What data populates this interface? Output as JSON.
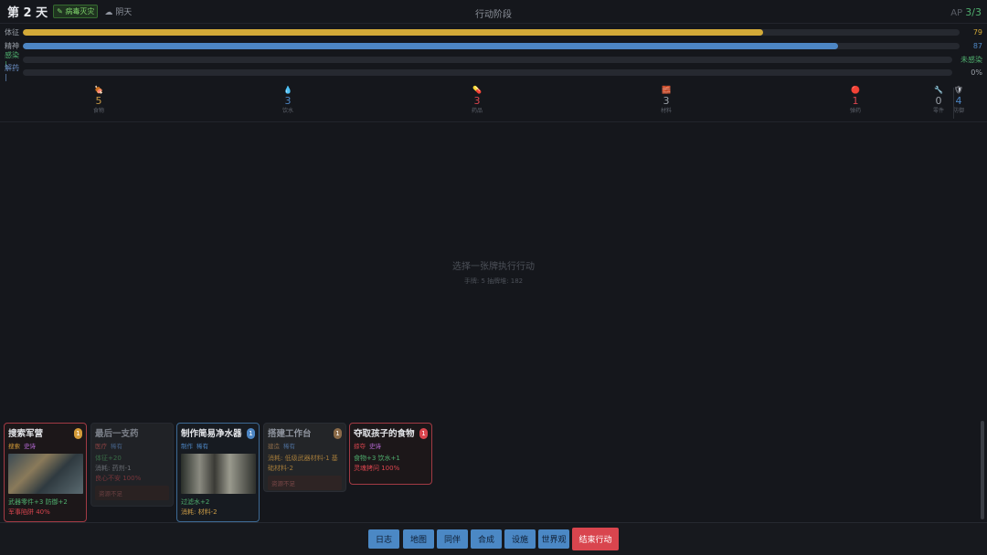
{
  "header": {
    "day_label": "第 2 天",
    "event_tag": "病毒灭灾",
    "weather": "阴天",
    "phase": "行动阶段",
    "ap_label": "AP",
    "ap_value": "3/3"
  },
  "stats": [
    {
      "label": "体征",
      "value": 79,
      "display": "79",
      "color": "#d3aa38",
      "val_color": "#d3aa38"
    },
    {
      "label": "精神",
      "value": 87,
      "display": "87",
      "color": "#4d86c4",
      "val_color": "#4d86c4"
    },
    {
      "label": "感染",
      "value": 0,
      "display": "未感染",
      "color": "#4fae6e",
      "val_color": "#4fae6e",
      "label_color": "#4fae6e"
    },
    {
      "label": "解药",
      "value": 0,
      "display": "0%",
      "color": "#6b8fc4",
      "val_color": "#9aa0a8",
      "label_color": "#6b8fc4"
    }
  ],
  "resources": [
    {
      "icon": "🍖",
      "value": "5",
      "label": "食物",
      "color": "#c89a46"
    },
    {
      "icon": "💧",
      "value": "3",
      "label": "饮水",
      "color": "#4d86c4"
    },
    {
      "icon": "💊",
      "value": "3",
      "label": "药品",
      "color": "#d9454e"
    },
    {
      "icon": "🧱",
      "value": "3",
      "label": "材料",
      "color": "#9aa0a8"
    },
    {
      "icon": "🔴",
      "value": "1",
      "label": "弹药",
      "color": "#d9454e"
    },
    {
      "icon": "🔧",
      "value": "0",
      "label": "零件",
      "color": "#9aa0a8"
    },
    {
      "icon": "🛡",
      "value": "4",
      "label": "防御",
      "color": "#4d86c4"
    }
  ],
  "center": {
    "prompt": "选择一张牌执行行动",
    "sub": "手牌: 5  抽牌堆: 182"
  },
  "cards": [
    {
      "title": "搜索军营",
      "badge": "1",
      "badge_color": "#d39a38",
      "tags": [
        "搜索",
        "史诗"
      ],
      "tag_colors": [
        "#d39a38",
        "#b86ad6"
      ],
      "lines": [
        "武器零件+3  防御+2",
        "军事陷阱 40%"
      ],
      "line_colors": [
        "#4fae6e",
        "#d9454e"
      ],
      "foot": ""
    },
    {
      "title": "最后一支药",
      "badge": "",
      "tags": [
        "医疗",
        "稀有"
      ],
      "tag_colors": [
        "#a04a4a",
        "#4d6f9a"
      ],
      "lines": [
        "体征+20",
        "消耗: 药剂-1",
        "良心不安 100%"
      ],
      "line_colors": [
        "#3f7a4e",
        "#777b83",
        "#8a3b40"
      ],
      "foot": "资源不足"
    },
    {
      "title": "制作简易净水器",
      "badge": "1",
      "badge_color": "#4d86c4",
      "tags": [
        "制作",
        "稀有"
      ],
      "tag_colors": [
        "#4d86c4",
        "#4d86c4"
      ],
      "lines": [
        "过滤水+2",
        "消耗: 材料-2"
      ],
      "line_colors": [
        "#4fae6e",
        "#c89a46"
      ],
      "foot": ""
    },
    {
      "title": "搭建工作台",
      "badge": "1",
      "badge_color": "#8a6a48",
      "tags": [
        "建造",
        "稀有"
      ],
      "tag_colors": [
        "#8a6a48",
        "#4d6f9a"
      ],
      "lines": [
        "消耗: 低级武器材料-1 基础材料-2"
      ],
      "line_colors": [
        "#a27a3a"
      ],
      "foot": "资源不足"
    },
    {
      "title": "夺取孩子的食物",
      "badge": "1",
      "badge_color": "#d9454e",
      "tags": [
        "掠夺",
        "史诗"
      ],
      "tag_colors": [
        "#d9454e",
        "#b86ad6"
      ],
      "lines": [
        "食物+3  饮水+1",
        "灵魂拷问 100%"
      ],
      "line_colors": [
        "#4fae6e",
        "#d9454e"
      ],
      "foot": ""
    }
  ],
  "buttons": [
    "日志",
    "地图",
    "同伴",
    "合成",
    "设施",
    "世界观",
    "结束行动"
  ]
}
